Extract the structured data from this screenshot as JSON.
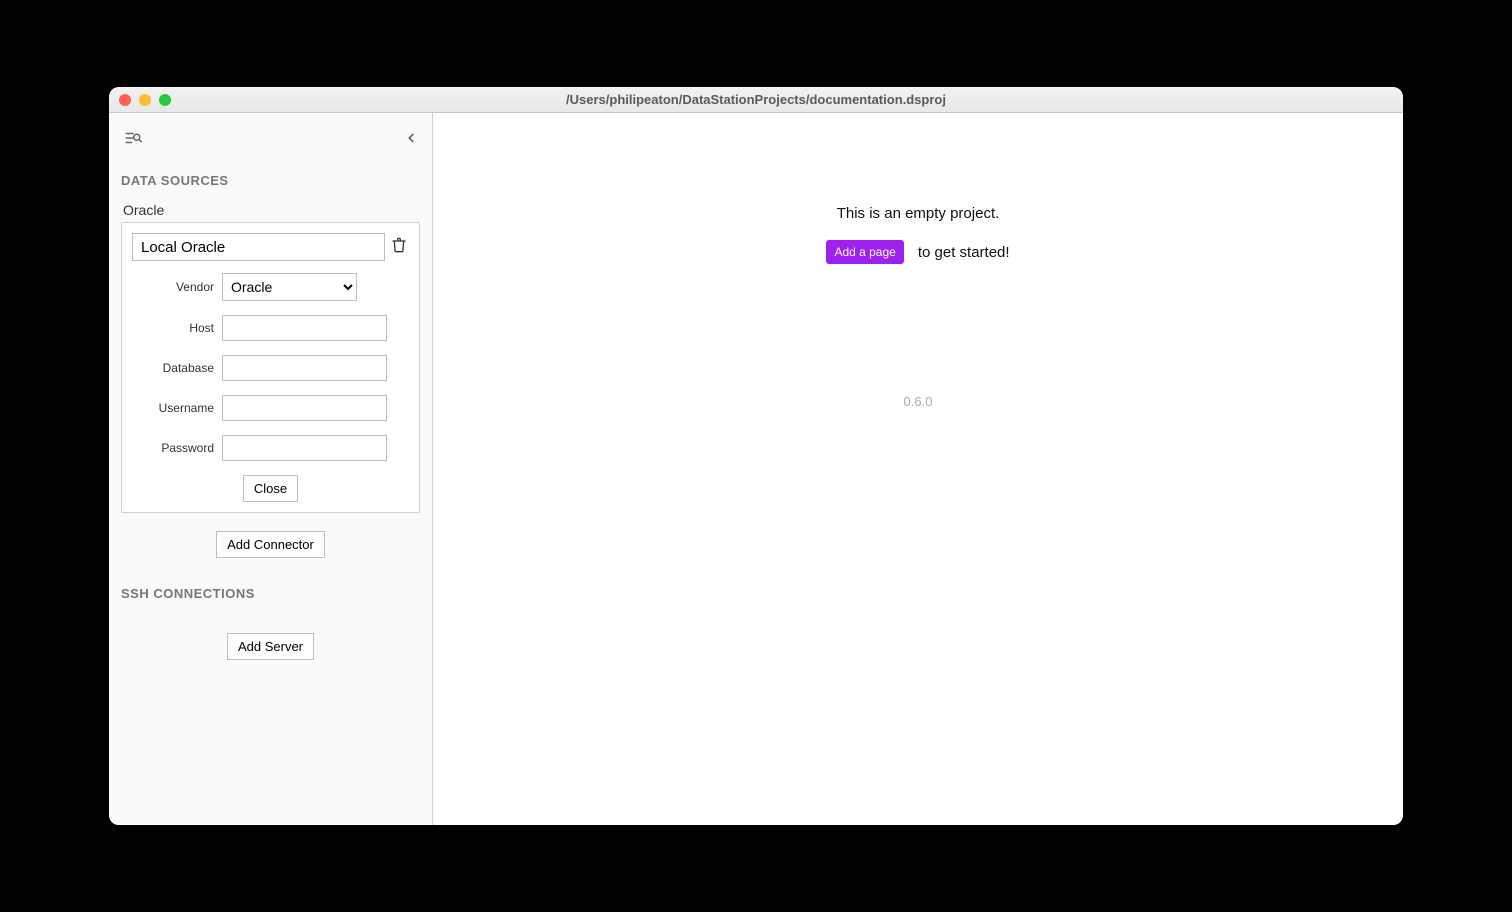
{
  "window": {
    "title": "/Users/philipeaton/DataStationProjects/documentation.dsproj"
  },
  "sidebar": {
    "sections": {
      "data_sources": {
        "header": "DATA SOURCES",
        "item_label": "Oracle",
        "connector": {
          "name": "Local Oracle",
          "fields": {
            "vendor": {
              "label": "Vendor",
              "value": "Oracle"
            },
            "host": {
              "label": "Host",
              "value": ""
            },
            "database": {
              "label": "Database",
              "value": ""
            },
            "username": {
              "label": "Username",
              "value": ""
            },
            "password": {
              "label": "Password",
              "value": ""
            }
          },
          "close_label": "Close"
        },
        "add_button": "Add Connector"
      },
      "ssh": {
        "header": "SSH CONNECTIONS",
        "add_button": "Add Server"
      }
    }
  },
  "main": {
    "empty_message": "This is an empty project.",
    "add_page_label": "Add a page",
    "get_started": "to get started!",
    "version": "0.6.0"
  }
}
